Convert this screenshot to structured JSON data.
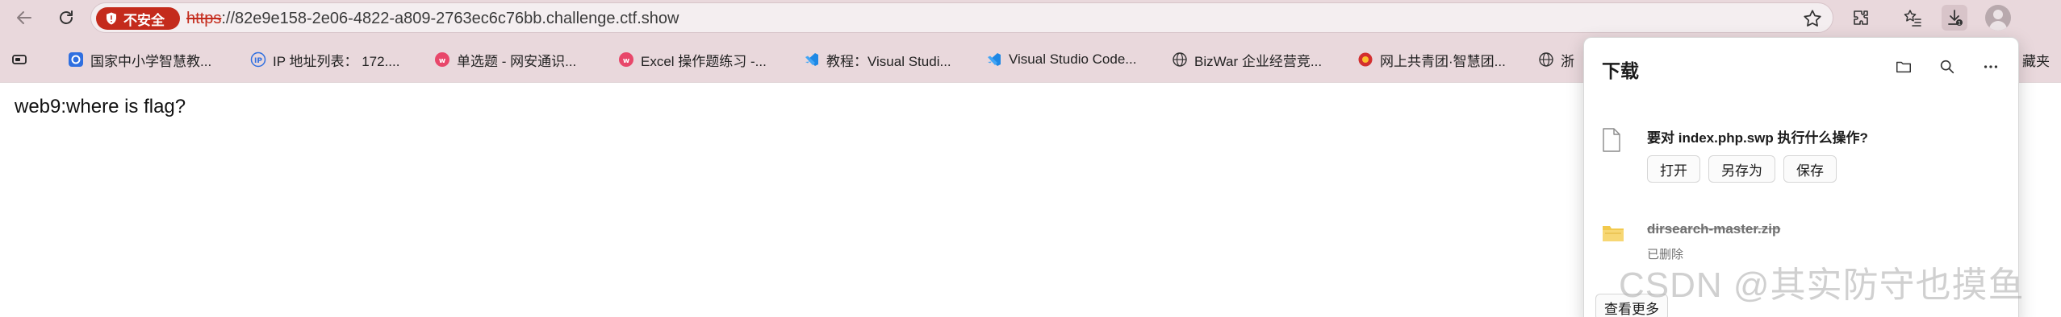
{
  "toolbar": {
    "security_label": "不安全",
    "url_scheme": "https",
    "url_rest": "://82e9e158-2e06-4822-a809-2763ec6c76bb.challenge.ctf.show"
  },
  "bookmarks": [
    {
      "label": "国家中小学智慧教...",
      "icon": "smart-edu-icon"
    },
    {
      "label": "IP 地址列表： 172....",
      "icon": "ip-icon"
    },
    {
      "label": "单选题 - 网安通识...",
      "icon": "quiz-app-icon"
    },
    {
      "label": "Excel 操作题练习 -...",
      "icon": "quiz-app-icon"
    },
    {
      "label": "教程：Visual Studi...",
      "icon": "vscode-icon"
    },
    {
      "label": "Visual Studio Code...",
      "icon": "vscode-icon"
    },
    {
      "label": "BizWar 企业经营竞...",
      "icon": "globe-icon"
    },
    {
      "label": "网上共青团·智慧团...",
      "icon": "youth-league-icon"
    },
    {
      "label": "浙",
      "icon": "globe-icon"
    },
    {
      "label": "藏夹",
      "icon": ""
    }
  ],
  "page": {
    "text": "web9:where is flag?"
  },
  "downloads": {
    "title": "下载",
    "item1": {
      "question": "要对 index.php.swp 执行什么操作?",
      "open_label": "打开",
      "save_as_label": "另存为",
      "save_label": "保存"
    },
    "item2": {
      "name": "dirsearch-master.zip",
      "status": "已删除"
    },
    "see_more_label": "查看更多"
  },
  "watermark": "CSDN @其实防守也摸鱼",
  "colors": {
    "chrome_bg": "#e9d8dc",
    "insecure_red": "#c42b1c",
    "vscode_blue": "#1e88e5"
  }
}
